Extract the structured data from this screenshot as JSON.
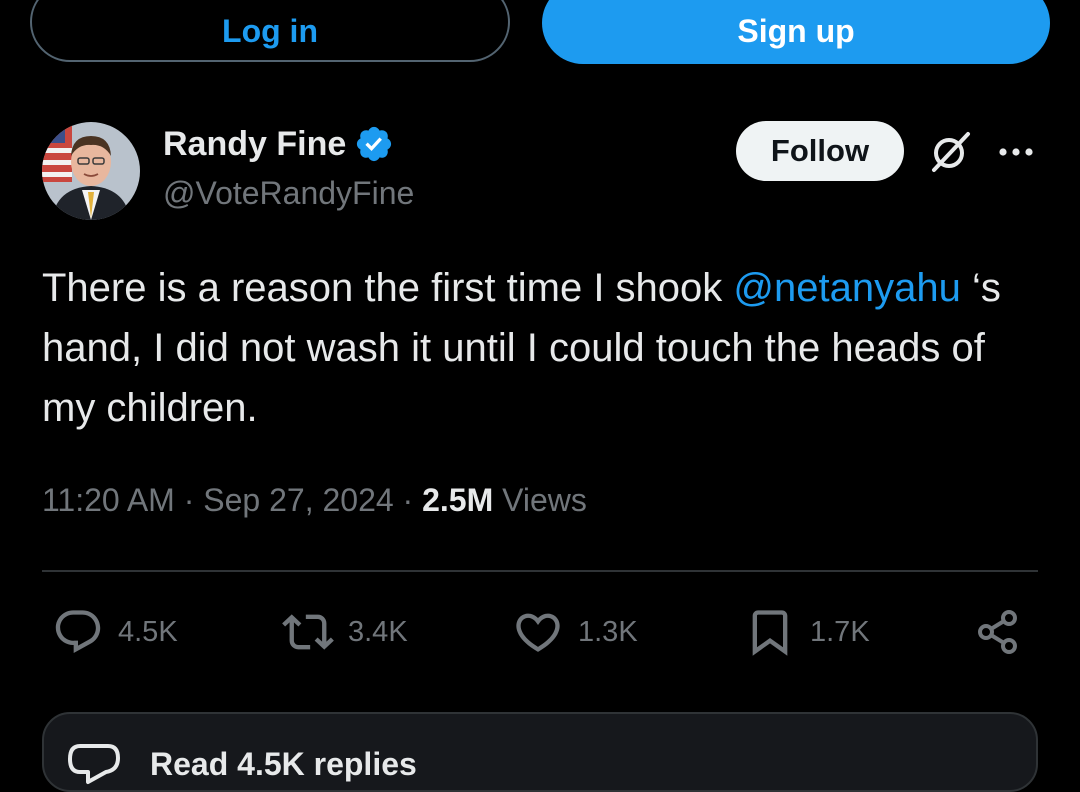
{
  "header": {
    "login_label": "Log in",
    "signup_label": "Sign up"
  },
  "author": {
    "name": "Randy Fine",
    "handle": "@VoteRandyFine",
    "verified": true,
    "follow_label": "Follow",
    "avatar_icon": "person-portrait",
    "grok_icon": "grok-icon",
    "more_icon": "more-icon"
  },
  "tweet": {
    "text_before": "There is a reason the first time I shook ",
    "mention": "@netanyahu",
    "text_after": " ‘s hand, I did not wash it until I could touch the heads of my children."
  },
  "meta": {
    "time": "11:20 AM",
    "separator": " · ",
    "date": "Sep 27, 2024",
    "views_count": "2.5M",
    "views_label": "Views"
  },
  "actions": {
    "replies": "4.5K",
    "reposts": "3.4K",
    "likes": "1.3K",
    "bookmarks": "1.7K"
  },
  "replies_card": {
    "label": "Read 4.5K replies"
  },
  "colors": {
    "accent": "#1d9bf0",
    "background": "#000000",
    "text": "#e7e9ea",
    "muted": "#71767b",
    "divider": "#2f3336"
  }
}
